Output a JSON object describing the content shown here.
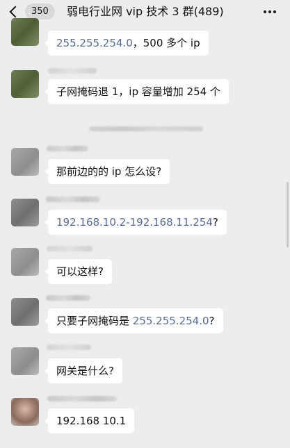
{
  "navbar": {
    "unread_count": "350",
    "title": "弱电行业网 vip 技术 3 群(489)",
    "icons": {
      "back": "chevron-left-icon",
      "more": "more-horizontal-icon"
    }
  },
  "messages": [
    {
      "ip": "255.255.254.0",
      "text": "，500 多个 ip"
    },
    {
      "text": "子网掩码退 1，ip 容量增加 254 个"
    },
    {
      "text": "那前边的的 ip 怎么设?"
    },
    {
      "ip": "192.168.10.2-192.168.11.254",
      "text": "?"
    },
    {
      "text": "可以这样?"
    },
    {
      "prefix": "只要子网掩码是 ",
      "ip": "255.255.254.0",
      "text": "?"
    },
    {
      "text": "网关是什么?"
    },
    {
      "text": "192.168 10.1"
    }
  ],
  "colors": {
    "background": "#ededed",
    "bubble": "#ffffff",
    "link": "#576b95"
  }
}
